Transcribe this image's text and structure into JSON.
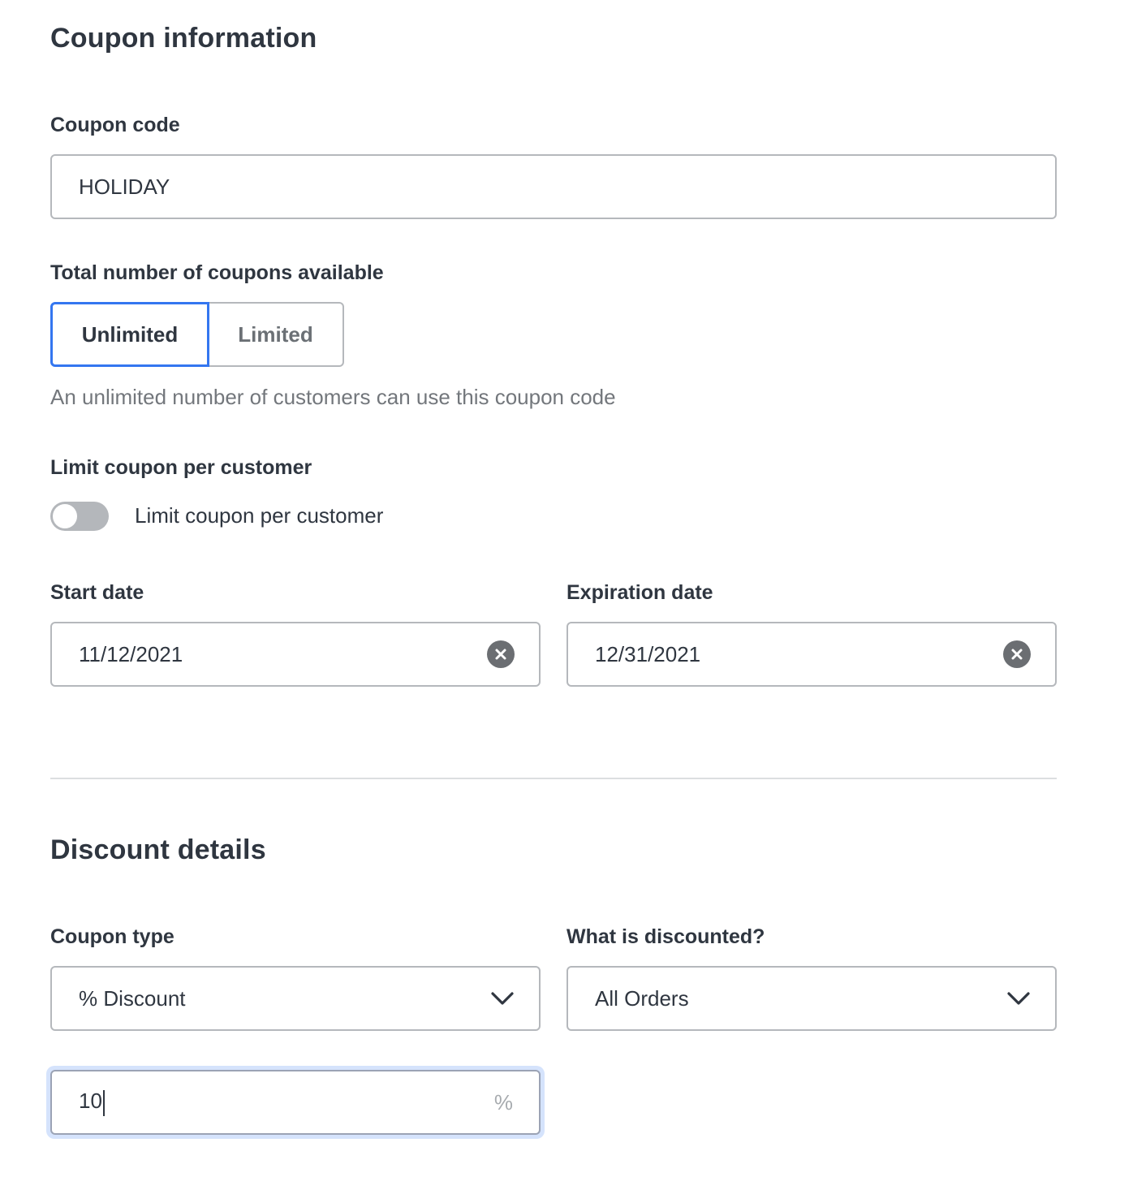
{
  "coupon_information": {
    "title": "Coupon information",
    "coupon_code": {
      "label": "Coupon code",
      "value": "HOLIDAY"
    },
    "total_available": {
      "label": "Total number of coupons available",
      "options": [
        {
          "label": "Unlimited",
          "selected": true
        },
        {
          "label": "Limited",
          "selected": false
        }
      ],
      "helper_text": "An unlimited number of customers can use this coupon code"
    },
    "limit_per_customer": {
      "label": "Limit coupon per customer",
      "toggle_label": "Limit coupon per customer",
      "enabled": false
    },
    "start_date": {
      "label": "Start date",
      "value": "11/12/2021",
      "clear_icon": "circle-x-icon"
    },
    "expiration_date": {
      "label": "Expiration date",
      "value": "12/31/2021",
      "clear_icon": "circle-x-icon"
    }
  },
  "discount_details": {
    "title": "Discount details",
    "coupon_type": {
      "label": "Coupon type",
      "selected": "% Discount",
      "icon": "chevron-down-icon"
    },
    "what_is_discounted": {
      "label": "What is discounted?",
      "selected": "All Orders",
      "icon": "chevron-down-icon"
    },
    "discount_amount": {
      "value": "10",
      "suffix": "%",
      "focused": true
    }
  },
  "colors": {
    "accent": "#3476f0",
    "text": "#2f3640",
    "muted_text": "#73777c",
    "border": "#b5b8bc",
    "focus_ring": "#d5e3fc",
    "toggle_off": "#b4b7bb",
    "divider": "#dcdee0"
  }
}
